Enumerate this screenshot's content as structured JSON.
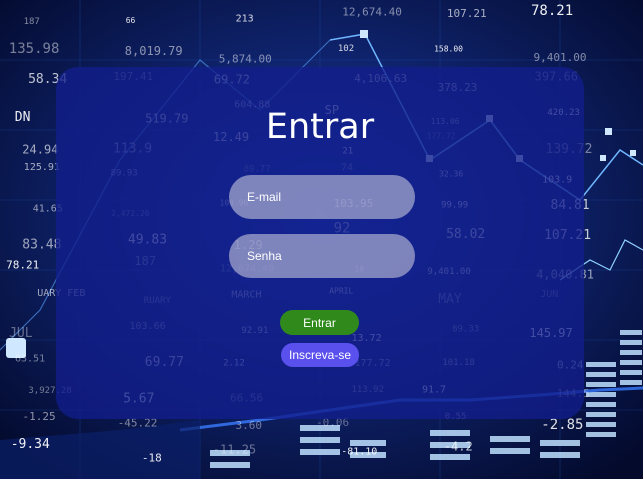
{
  "login": {
    "title": "Entrar",
    "email_placeholder": "E-mail",
    "password_placeholder": "Senha",
    "login_button": "Entrar",
    "signup_button": "Inscreva-se"
  },
  "background_numbers": [
    "187",
    "66",
    "213",
    "12,674.40",
    "107.21",
    "78.21",
    "135.98",
    "8,019.79",
    "5,874.00",
    "102",
    "158.00",
    "9,401.00",
    "58.34",
    "197.41",
    "69.72",
    "4,106.63",
    "378.23",
    "397.66",
    "DN",
    "519.79",
    "604.88",
    "SP",
    "113.06",
    "420.23",
    "24.94",
    "113.9",
    "12.49",
    "21",
    "177.72",
    "139.72",
    "125.91",
    "89.93",
    "89.77",
    "74",
    "32.36",
    "103.9",
    "41.65",
    "2,472.26",
    "100.96",
    "103.95",
    "99.99",
    "84.81",
    "83.48",
    "49.83",
    "1.29",
    "92",
    "58.02",
    "107.21",
    "78.21",
    "187",
    "12,674.40",
    "18",
    "9,401.00",
    "4,040.81",
    "UARY FEB",
    "RUARY",
    "MARCH",
    "APRIL",
    "MAY",
    "JUN",
    "JUL",
    "103.66",
    "92.91",
    "13.72",
    "89.33",
    "145.97",
    "63.51",
    "69.77",
    "2.12",
    "177.72",
    "101.18",
    "0.24",
    "3,927.28",
    "5.67",
    "66.56",
    "113.92",
    "91.7",
    "144.5",
    "-1.25",
    "-45.22",
    "3.60",
    "-0.06",
    "0.55",
    "-2.85",
    "-9.34",
    "-18",
    "-11.25",
    "-81.10",
    "-4.2"
  ],
  "colors": {
    "panel": "#121e8c",
    "login_button": "#2f8a1b",
    "signup_button": "#5a50ee",
    "field": "#d7d7e4",
    "text": "#ffffff"
  }
}
